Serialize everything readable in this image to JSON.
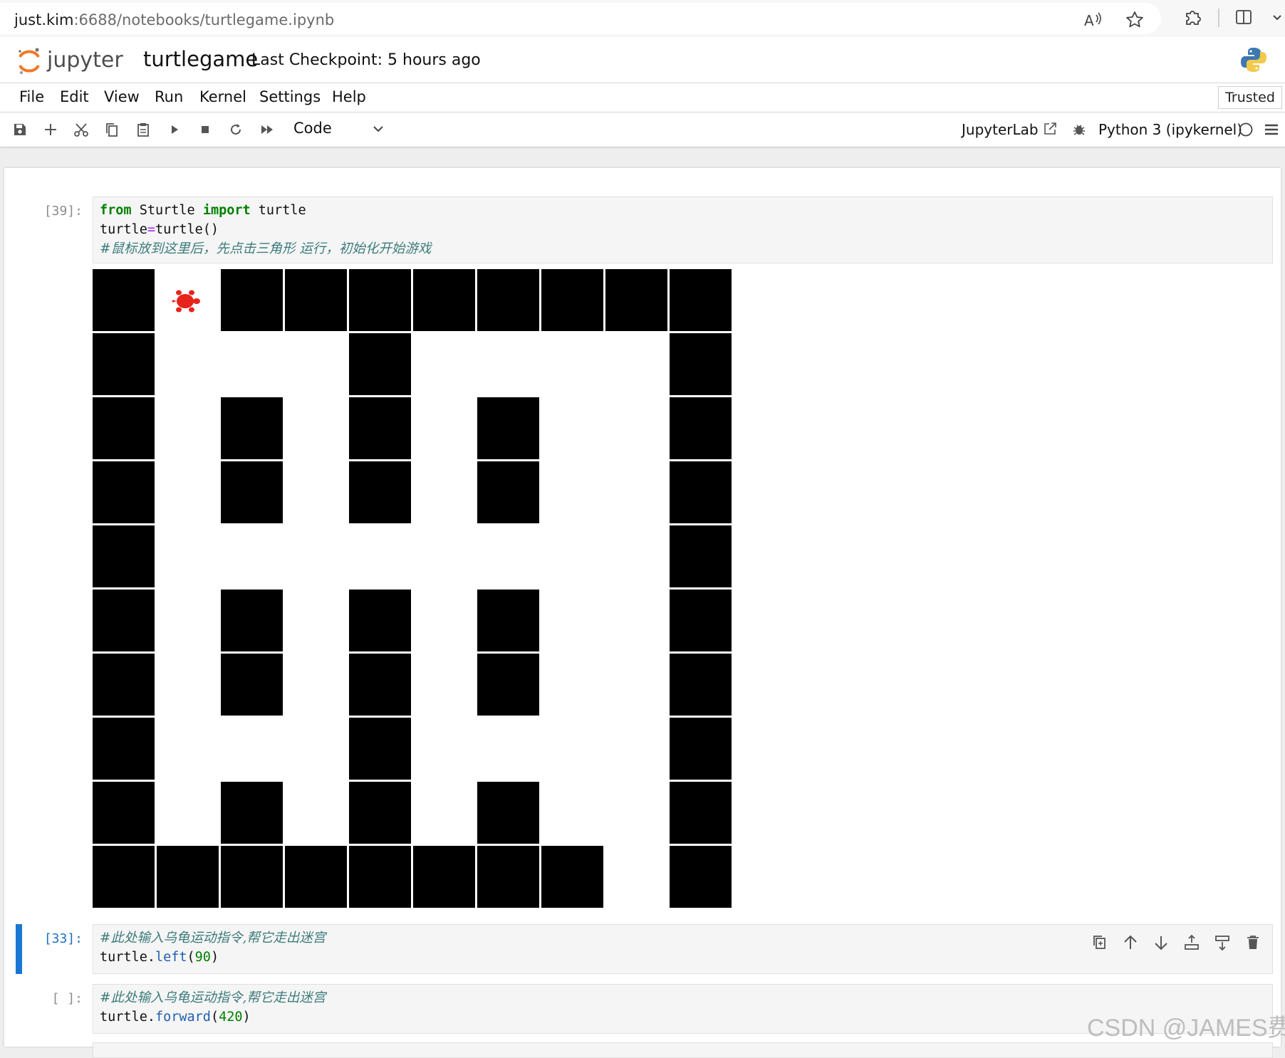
{
  "browser": {
    "url_host": "just.kim",
    "url_rest": ":6688/notebooks/turtlegame.ipynb",
    "icons": [
      "read-aloud-icon",
      "favorite-star-icon",
      "extensions-icon",
      "split-screen-icon",
      "more-chevron-icon"
    ]
  },
  "header": {
    "logo_text": "jupyter",
    "notebook_name": "turtlegame",
    "checkpoint": "Last Checkpoint: 5 hours ago"
  },
  "menu": {
    "items": [
      "File",
      "Edit",
      "View",
      "Run",
      "Kernel",
      "Settings",
      "Help"
    ],
    "trusted": "Trusted"
  },
  "toolbar": {
    "cell_type": "Code",
    "jupyterlab_label": "JupyterLab",
    "kernel_name": "Python 3 (ipykernel)"
  },
  "cells": [
    {
      "prompt": "[39]:",
      "lines": [
        [
          {
            "t": "kw",
            "v": "from"
          },
          {
            "t": "",
            "v": " Sturtle "
          },
          {
            "t": "kw",
            "v": "import"
          },
          {
            "t": "",
            "v": " turtle"
          }
        ],
        [
          {
            "t": "",
            "v": "turtle"
          },
          {
            "t": "op",
            "v": "="
          },
          {
            "t": "",
            "v": "turtle()"
          }
        ],
        [
          {
            "t": "cm",
            "v": "#鼠标放到这里后，先点击三角形 运行，初始化开始游戏"
          }
        ]
      ]
    },
    {
      "prompt": "[33]:",
      "lines": [
        [
          {
            "t": "cm",
            "v": "#此处输入乌龟运动指令,帮它走出迷宫"
          }
        ],
        [
          {
            "t": "",
            "v": "turtle."
          },
          {
            "t": "fn",
            "v": "left"
          },
          {
            "t": "",
            "v": "("
          },
          {
            "t": "num",
            "v": "90"
          },
          {
            "t": "",
            "v": ")"
          }
        ]
      ]
    },
    {
      "prompt": "[ ]:",
      "lines": [
        [
          {
            "t": "cm",
            "v": "#此处输入乌龟运动指令,帮它走出迷宫"
          }
        ],
        [
          {
            "t": "",
            "v": "turtle."
          },
          {
            "t": "fn",
            "v": "forward"
          },
          {
            "t": "",
            "v": "("
          },
          {
            "t": "num",
            "v": "420"
          },
          {
            "t": "",
            "v": ")"
          }
        ]
      ]
    }
  ],
  "maze": {
    "rows": [
      "1.11111111",
      "1...1....1",
      "1.1.1.1..1",
      "1.1.1.1..1",
      "1........1",
      "1.1.1.1..1",
      "1.1.1.1..1",
      "1...1....1",
      "1.1.1.1..1",
      "11111111.1"
    ],
    "turtle_color": "#e8231b",
    "wall_color": "#000000",
    "turtle_cell": [
      0,
      1
    ]
  },
  "cell_toolbar_icons": [
    "duplicate-cell-icon",
    "move-up-icon",
    "move-down-icon",
    "insert-above-icon",
    "insert-below-icon",
    "delete-cell-icon"
  ],
  "watermark": "CSDN @JAMES费"
}
